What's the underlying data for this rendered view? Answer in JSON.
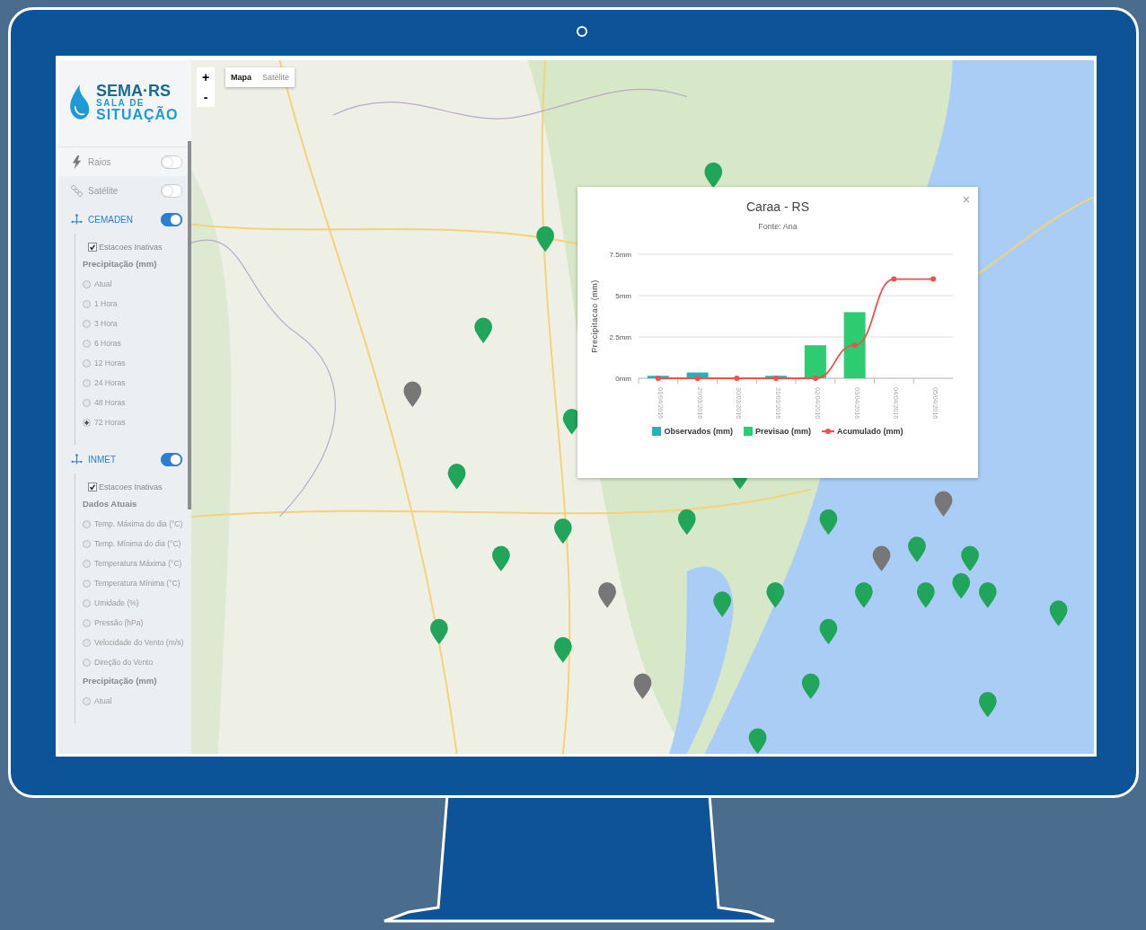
{
  "brand": {
    "name": "SEMA·RS",
    "line_1": "SALA DE",
    "line_2": "SITUAÇÃO"
  },
  "layers": [
    {
      "kind": "lightning",
      "label": "Raios",
      "on": false
    },
    {
      "kind": "satellite",
      "label": "Satélite",
      "on": false
    },
    {
      "kind": "station",
      "label": "CEMADEN",
      "on": true,
      "inactive_stations": {
        "label": "Estacoes Inativas",
        "checked": true
      },
      "sections": [
        {
          "heading": "Precipitação (mm)",
          "options": [
            {
              "label": "Atual",
              "selected": false
            },
            {
              "label": "1 Hora",
              "selected": false
            },
            {
              "label": "3 Hora",
              "selected": false
            },
            {
              "label": "6 Horas",
              "selected": false
            },
            {
              "label": "12 Horas",
              "selected": false
            },
            {
              "label": "24 Horas",
              "selected": false
            },
            {
              "label": "48 Horas",
              "selected": false
            },
            {
              "label": "72 Horas",
              "selected": true
            }
          ]
        }
      ]
    },
    {
      "kind": "station",
      "label": "INMET",
      "on": true,
      "inactive_stations": {
        "label": "Estacoes Inativas",
        "checked": true
      },
      "sections": [
        {
          "heading": "Dados Atuais",
          "options": [
            {
              "label": "Temp. Máxima do dia (°C)",
              "selected": false
            },
            {
              "label": "Temp. Mínima do dia (°C)",
              "selected": false
            },
            {
              "label": "Temperatura Máxima (°C)",
              "selected": false
            },
            {
              "label": "Temperatura Mínima (°C)",
              "selected": false
            },
            {
              "label": "Umidade (%)",
              "selected": false
            },
            {
              "label": "Pressão (hPa)",
              "selected": false
            },
            {
              "label": "Velocidade do Vento (m/s)",
              "selected": false
            },
            {
              "label": "Direção do Vento",
              "selected": false
            }
          ]
        },
        {
          "heading": "Precipitação (mm)",
          "options": [
            {
              "label": "Atual",
              "selected": false
            }
          ]
        }
      ]
    }
  ],
  "map_controls": {
    "zoom_in": "+",
    "zoom_out": "-",
    "map_types": [
      {
        "label": "Mapa",
        "selected": true
      },
      {
        "label": "Satélite",
        "selected": false
      }
    ]
  },
  "popup": {
    "title": "Caraa - RS",
    "subtitle": "Fonte: Ana",
    "close": "×",
    "chart_data": {
      "type": "bar",
      "ylabel": "Precipitacao (mm)",
      "categories": [
        "01/04/2016",
        "29/03/2016",
        "30/03/2016",
        "31/03/2016",
        "02/04/2016",
        "03/04/2016",
        "04/04/2016",
        "05/04/2016"
      ],
      "ylim": [
        0,
        7.5
      ],
      "yticks": [
        {
          "value": 0,
          "label": "0mm"
        },
        {
          "value": 2.5,
          "label": "2.5mm"
        },
        {
          "value": 5,
          "label": "5mm"
        },
        {
          "value": 7.5,
          "label": "7.5mm"
        }
      ],
      "series": [
        {
          "name": "Observados (mm)",
          "type": "bar",
          "color": "#2ab0b8",
          "values": [
            0.15,
            0.35,
            0,
            0.15,
            0,
            0,
            0,
            0
          ]
        },
        {
          "name": "Previsao (mm)",
          "type": "bar",
          "color": "#2ecc71",
          "values": [
            0,
            0,
            0,
            0,
            2,
            4,
            0,
            0
          ]
        },
        {
          "name": "Acumulado (mm)",
          "type": "line",
          "color": "#f0504a",
          "marker": "circle",
          "values": [
            0,
            0,
            0,
            0,
            0,
            2,
            6,
            6
          ]
        }
      ]
    }
  }
}
